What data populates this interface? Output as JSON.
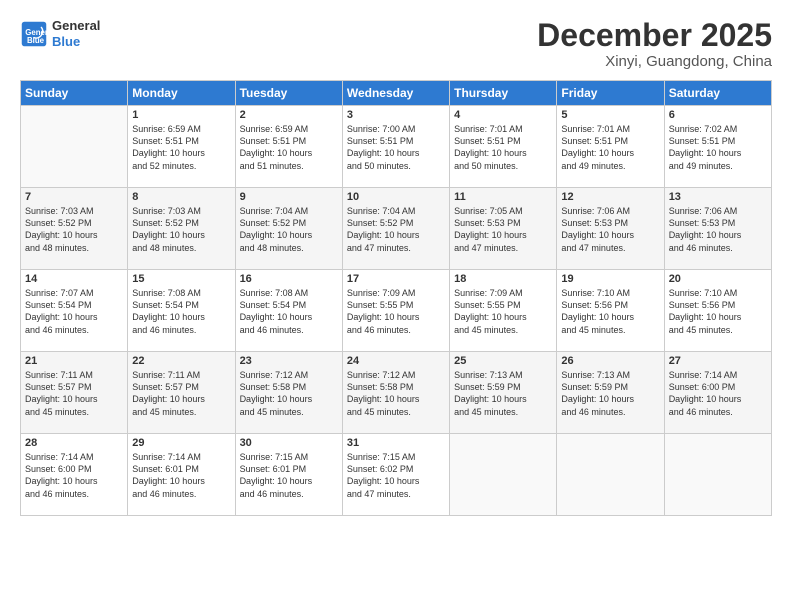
{
  "logo": {
    "line1": "General",
    "line2": "Blue"
  },
  "title": "December 2025",
  "subtitle": "Xinyi, Guangdong, China",
  "columns": [
    "Sunday",
    "Monday",
    "Tuesday",
    "Wednesday",
    "Thursday",
    "Friday",
    "Saturday"
  ],
  "weeks": [
    [
      {
        "day": "",
        "info": ""
      },
      {
        "day": "1",
        "info": "Sunrise: 6:59 AM\nSunset: 5:51 PM\nDaylight: 10 hours\nand 52 minutes."
      },
      {
        "day": "2",
        "info": "Sunrise: 6:59 AM\nSunset: 5:51 PM\nDaylight: 10 hours\nand 51 minutes."
      },
      {
        "day": "3",
        "info": "Sunrise: 7:00 AM\nSunset: 5:51 PM\nDaylight: 10 hours\nand 50 minutes."
      },
      {
        "day": "4",
        "info": "Sunrise: 7:01 AM\nSunset: 5:51 PM\nDaylight: 10 hours\nand 50 minutes."
      },
      {
        "day": "5",
        "info": "Sunrise: 7:01 AM\nSunset: 5:51 PM\nDaylight: 10 hours\nand 49 minutes."
      },
      {
        "day": "6",
        "info": "Sunrise: 7:02 AM\nSunset: 5:51 PM\nDaylight: 10 hours\nand 49 minutes."
      }
    ],
    [
      {
        "day": "7",
        "info": "Sunrise: 7:03 AM\nSunset: 5:52 PM\nDaylight: 10 hours\nand 48 minutes."
      },
      {
        "day": "8",
        "info": "Sunrise: 7:03 AM\nSunset: 5:52 PM\nDaylight: 10 hours\nand 48 minutes."
      },
      {
        "day": "9",
        "info": "Sunrise: 7:04 AM\nSunset: 5:52 PM\nDaylight: 10 hours\nand 48 minutes."
      },
      {
        "day": "10",
        "info": "Sunrise: 7:04 AM\nSunset: 5:52 PM\nDaylight: 10 hours\nand 47 minutes."
      },
      {
        "day": "11",
        "info": "Sunrise: 7:05 AM\nSunset: 5:53 PM\nDaylight: 10 hours\nand 47 minutes."
      },
      {
        "day": "12",
        "info": "Sunrise: 7:06 AM\nSunset: 5:53 PM\nDaylight: 10 hours\nand 47 minutes."
      },
      {
        "day": "13",
        "info": "Sunrise: 7:06 AM\nSunset: 5:53 PM\nDaylight: 10 hours\nand 46 minutes."
      }
    ],
    [
      {
        "day": "14",
        "info": "Sunrise: 7:07 AM\nSunset: 5:54 PM\nDaylight: 10 hours\nand 46 minutes."
      },
      {
        "day": "15",
        "info": "Sunrise: 7:08 AM\nSunset: 5:54 PM\nDaylight: 10 hours\nand 46 minutes."
      },
      {
        "day": "16",
        "info": "Sunrise: 7:08 AM\nSunset: 5:54 PM\nDaylight: 10 hours\nand 46 minutes."
      },
      {
        "day": "17",
        "info": "Sunrise: 7:09 AM\nSunset: 5:55 PM\nDaylight: 10 hours\nand 46 minutes."
      },
      {
        "day": "18",
        "info": "Sunrise: 7:09 AM\nSunset: 5:55 PM\nDaylight: 10 hours\nand 45 minutes."
      },
      {
        "day": "19",
        "info": "Sunrise: 7:10 AM\nSunset: 5:56 PM\nDaylight: 10 hours\nand 45 minutes."
      },
      {
        "day": "20",
        "info": "Sunrise: 7:10 AM\nSunset: 5:56 PM\nDaylight: 10 hours\nand 45 minutes."
      }
    ],
    [
      {
        "day": "21",
        "info": "Sunrise: 7:11 AM\nSunset: 5:57 PM\nDaylight: 10 hours\nand 45 minutes."
      },
      {
        "day": "22",
        "info": "Sunrise: 7:11 AM\nSunset: 5:57 PM\nDaylight: 10 hours\nand 45 minutes."
      },
      {
        "day": "23",
        "info": "Sunrise: 7:12 AM\nSunset: 5:58 PM\nDaylight: 10 hours\nand 45 minutes."
      },
      {
        "day": "24",
        "info": "Sunrise: 7:12 AM\nSunset: 5:58 PM\nDaylight: 10 hours\nand 45 minutes."
      },
      {
        "day": "25",
        "info": "Sunrise: 7:13 AM\nSunset: 5:59 PM\nDaylight: 10 hours\nand 45 minutes."
      },
      {
        "day": "26",
        "info": "Sunrise: 7:13 AM\nSunset: 5:59 PM\nDaylight: 10 hours\nand 46 minutes."
      },
      {
        "day": "27",
        "info": "Sunrise: 7:14 AM\nSunset: 6:00 PM\nDaylight: 10 hours\nand 46 minutes."
      }
    ],
    [
      {
        "day": "28",
        "info": "Sunrise: 7:14 AM\nSunset: 6:00 PM\nDaylight: 10 hours\nand 46 minutes."
      },
      {
        "day": "29",
        "info": "Sunrise: 7:14 AM\nSunset: 6:01 PM\nDaylight: 10 hours\nand 46 minutes."
      },
      {
        "day": "30",
        "info": "Sunrise: 7:15 AM\nSunset: 6:01 PM\nDaylight: 10 hours\nand 46 minutes."
      },
      {
        "day": "31",
        "info": "Sunrise: 7:15 AM\nSunset: 6:02 PM\nDaylight: 10 hours\nand 47 minutes."
      },
      {
        "day": "",
        "info": ""
      },
      {
        "day": "",
        "info": ""
      },
      {
        "day": "",
        "info": ""
      }
    ]
  ]
}
